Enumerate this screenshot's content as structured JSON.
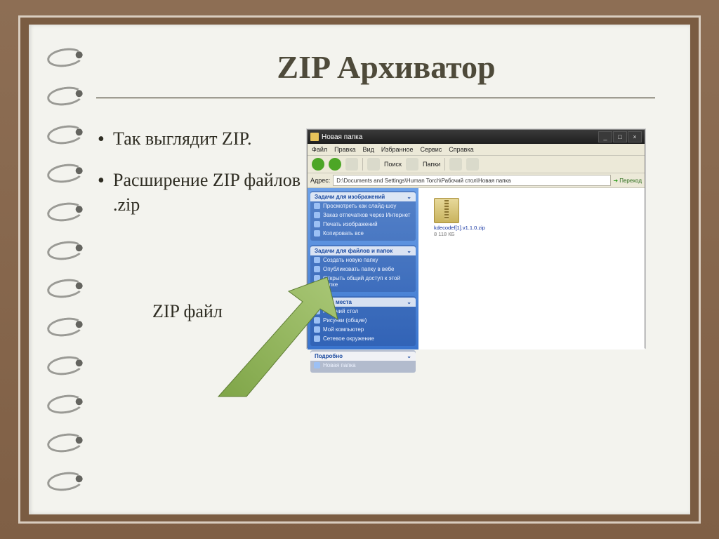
{
  "slide": {
    "title": "ZIP Архиватор",
    "bullets": [
      "Так выглядит ZIP.",
      "Расширение ZIP файлов .zip"
    ],
    "zip_caption": "ZIP файл"
  },
  "explorer": {
    "window_title": "Новая папка",
    "menu": [
      "Файл",
      "Правка",
      "Вид",
      "Избранное",
      "Сервис",
      "Справка"
    ],
    "toolbar_labels": {
      "search": "Поиск",
      "folders": "Папки"
    },
    "address_label": "Адрес:",
    "address_value": "D:\\Documents and Settings\\Human Torch\\Рабочий стол\\Новая папка",
    "go_label": "Переход",
    "side_groups": {
      "images": {
        "header": "Задачи для изображений",
        "items": [
          "Просмотреть как слайд-шоу",
          "Заказ отпечатков через Интернет",
          "Печать изображений",
          "Копировать все"
        ]
      },
      "files": {
        "header": "Задачи для файлов и папок",
        "items": [
          "Создать новую папку",
          "Опубликовать папку в вебе",
          "Открыть общий доступ к этой папке"
        ]
      },
      "places": {
        "header": "Другие места",
        "items": [
          "Рабочий стол",
          "Рисунки (общие)",
          "Мой компьютер",
          "Сетевое окружение"
        ]
      },
      "details": {
        "header": "Подробно",
        "items": [
          "Новая папка"
        ]
      }
    },
    "file": {
      "name": "kdecodef[1].v1.1.0.zip",
      "size": "8 118 КБ"
    }
  }
}
